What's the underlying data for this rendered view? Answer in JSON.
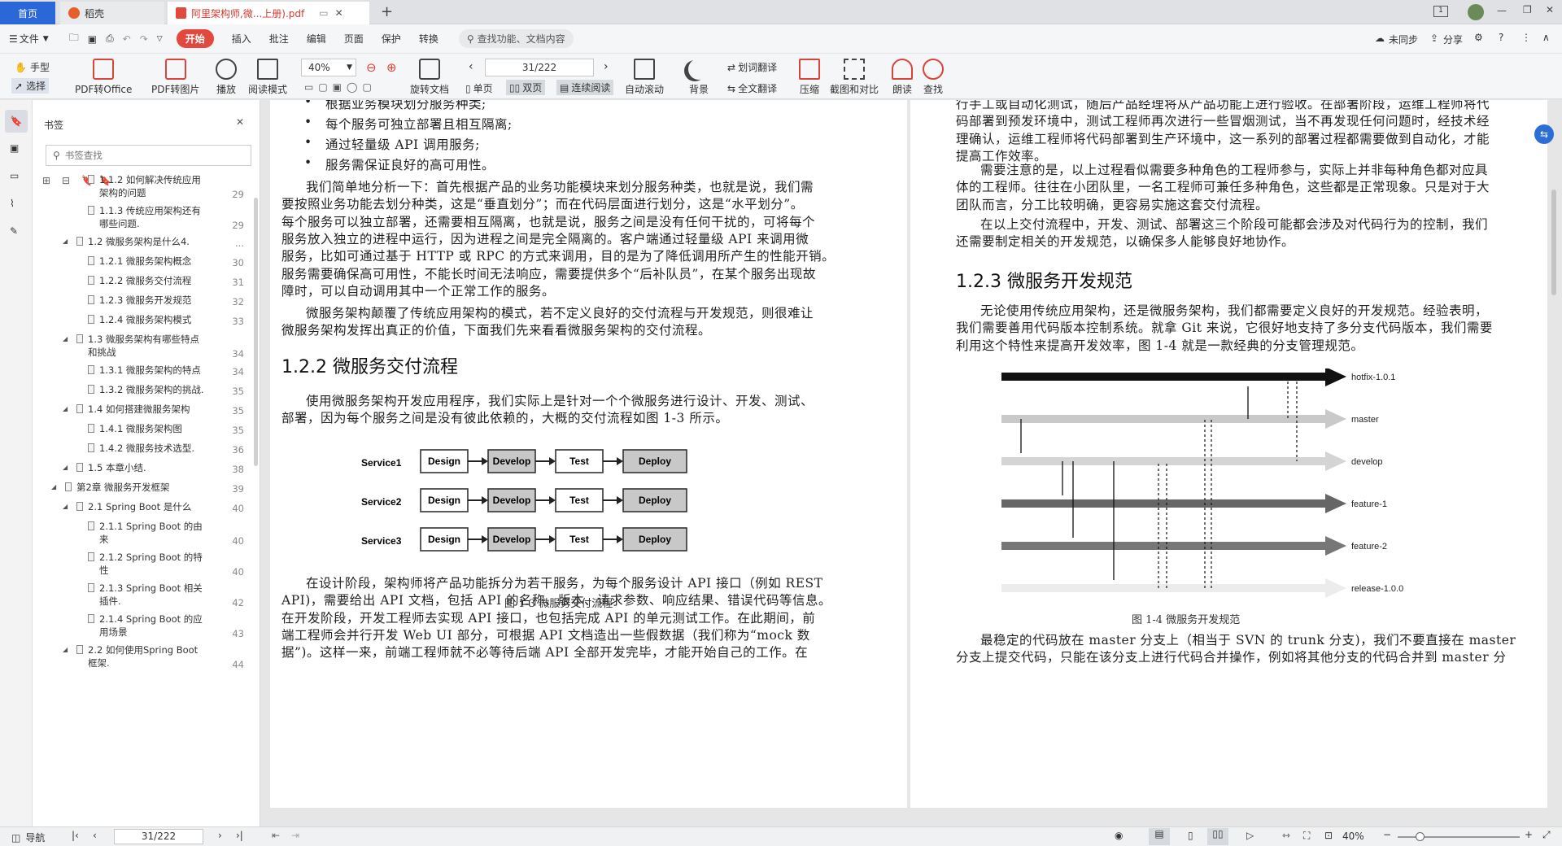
{
  "tabs": {
    "home": "首页",
    "daoke": "稻壳",
    "doc": "阿里架构师,微...上册).pdf"
  },
  "menu": {
    "file": "文件",
    "start": "开始",
    "items": [
      "插入",
      "批注",
      "编辑",
      "页面",
      "保护",
      "转换"
    ],
    "search": "查找功能、文档内容",
    "sync": "未同步",
    "share": "分享"
  },
  "ribbon": {
    "hand": "手型",
    "select": "选择",
    "pdf2office": "PDF转Office",
    "pdf2img": "PDF转图片",
    "play": "播放",
    "readmode": "阅读模式",
    "zoom": "40%",
    "page": "31/222",
    "rotate": "旋转文档",
    "single": "单页",
    "double": "双页",
    "continuous": "连续阅读",
    "autoscroll": "自动滚动",
    "background": "背景",
    "wordtrans": "划词翻译",
    "fulltrans": "全文翻译",
    "compress": "压缩",
    "screenshot": "截图和对比",
    "read": "朗读",
    "find": "查找"
  },
  "sidebar": {
    "title": "书签",
    "search_placeholder": "书签查找",
    "items": [
      {
        "l": "1.1.2 如何解决传统应用",
        "l2": "架构的问题",
        "p": "29",
        "lv": 2
      },
      {
        "l": "1.1.3 传统应用架构还有",
        "l2": "哪些问题.",
        "p": "29",
        "lv": 2
      },
      {
        "l": "1.2 微服务架构是什么4.",
        "l2": "",
        "p": "...",
        "lv": 1
      },
      {
        "l": "1.2.1 微服务架构概念",
        "l2": "",
        "p": "30",
        "lv": 2
      },
      {
        "l": "1.2.2 微服务交付流程",
        "l2": "",
        "p": "31",
        "lv": 2
      },
      {
        "l": "1.2.3 微服务开发规范",
        "l2": "",
        "p": "32",
        "lv": 2
      },
      {
        "l": "1.2.4 微服务架构模式",
        "l2": "",
        "p": "33",
        "lv": 2
      },
      {
        "l": "1.3 微服务架构有哪些特点",
        "l2": "和挑战",
        "p": "34",
        "lv": 1
      },
      {
        "l": "1.3.1 微服务架构的特点",
        "l2": "",
        "p": "34",
        "lv": 2
      },
      {
        "l": "1.3.2 微服务架构的挑战.",
        "l2": "",
        "p": "35",
        "lv": 2
      },
      {
        "l": "1.4 如何搭建微服务架构",
        "l2": "",
        "p": "35",
        "lv": 1
      },
      {
        "l": "1.4.1 微服务架构图",
        "l2": "",
        "p": "35",
        "lv": 2
      },
      {
        "l": "1.4.2 微服务技术选型.",
        "l2": "",
        "p": "36",
        "lv": 2
      },
      {
        "l": "1.5 本章小结.",
        "l2": "",
        "p": "38",
        "lv": 1
      },
      {
        "l": "第2章 微服务开发框架",
        "l2": "",
        "p": "39",
        "lv": 0
      },
      {
        "l": "2.1 Spring Boot 是什么",
        "l2": "",
        "p": "40",
        "lv": 1
      },
      {
        "l": "2.1.1 Spring Boot 的由",
        "l2": "来",
        "p": "40",
        "lv": 2
      },
      {
        "l": "2.1.2 Spring Boot 的特",
        "l2": "性",
        "p": "40",
        "lv": 2
      },
      {
        "l": "2.1.3 Spring Boot 相关",
        "l2": "插件.",
        "p": "42",
        "lv": 2
      },
      {
        "l": "2.1.4 Spring Boot 的应",
        "l2": "用场景",
        "p": "43",
        "lv": 2
      },
      {
        "l": "2.2 如何使用Spring Boot",
        "l2": "框架.",
        "p": "44",
        "lv": 1
      }
    ]
  },
  "left_page": {
    "bullets": [
      "根据业务模块划分服务种类;",
      "每个服务可独立部署且相互隔离;",
      "通过轻量级 API 调用服务;",
      "服务需保证良好的高可用性。"
    ],
    "para1": [
      "我们简单地分析一下：首先根据产品的业务功能模块来划分服务种类，也就是说，我们需",
      "要按照业务功能去划分种类，这是“垂直划分”；而在代码层面进行划分，这是“水平划分”。",
      "每个服务可以独立部署，还需要相互隔离，也就是说，服务之间是没有任何干扰的，可将每个",
      "服务放入独立的进程中运行，因为进程之间是完全隔离的。客户端通过轻量级 API 来调用微",
      "服务，比如可通过基于 HTTP 或 RPC 的方式来调用，目的是为了降低调用所产生的性能开销。",
      "服务需要确保高可用性，不能长时间无法响应，需要提供多个“后补队员”，在某个服务出现故",
      "障时，可以自动调用其中一个正常工作的服务。"
    ],
    "para2": [
      "微服务架构颠覆了传统应用架构的模式，若不定义良好的交付流程与开发规范，则很难让",
      "微服务架构发挥出真正的价值，下面我们先来看看微服务架构的交付流程。"
    ],
    "heading": "1.2.2   微服务交付流程",
    "para3": [
      "使用微服务架构开发应用程序，我们实际上是针对一个个微服务进行设计、开发、测试、",
      "部署，因为每个服务之间是没有彼此依赖的，大概的交付流程如图 1-3 所示。"
    ],
    "fig_services": [
      "Service1",
      "Service2",
      "Service3"
    ],
    "fig_steps": [
      "Design",
      "Develop",
      "Test",
      "Deploy"
    ],
    "fig_caption": "图 1-3    微服务交付流程",
    "para4": [
      "在设计阶段，架构师将产品功能拆分为若干服务，为每个服务设计 API 接口（例如 REST",
      "API)，需要给出 API 文档，包括 API 的名称、版本、请求参数、响应结果、错误代码等信息。",
      "在开发阶段，开发工程师去实现 API 接口，也包括完成 API 的单元测试工作。在此期间，前",
      "端工程师会并行开发 Web UI 部分，可根据 API 文档造出一些假数据（我们称为“mock 数",
      "据”)。这样一来，前端工程师就不必等待后端 API 全部开发完毕，才能开始自己的工作。在"
    ]
  },
  "right_page": {
    "para1": [
      "行手工或自动化测试，随后产品经理将从产品功能上进行验收。在部署阶段，运维工程师将代",
      "码部署到预发环境中，测试工程师再次进行一些冒烟测试，当不再发现任何问题时，经技术经",
      "理确认，运维工程师将代码部署到生产环境中，这一系列的部署过程都需要做到自动化，才能",
      "提高工作效率。"
    ],
    "para2": [
      "需要注意的是，以上过程看似需要多种角色的工程师参与，实际上并非每种角色都对应具",
      "体的工程师。往往在小团队里，一名工程师可兼任多种角色，这些都是正常现象。只是对于大",
      "团队而言，分工比较明确，更容易实施这套交付流程。"
    ],
    "para3": [
      "在以上交付流程中，开发、测试、部署这三个阶段可能都会涉及对代码行为的控制，我们",
      "还需要制定相关的开发规范，以确保多人能够良好地协作。"
    ],
    "heading": "1.2.3   微服务开发规范",
    "para4": [
      "无论使用传统应用架构，还是微服务架构，我们都需要定义良好的开发规范。经验表明，",
      "我们需要善用代码版本控制系统。就拿 Git 来说，它很好地支持了多分支代码版本，我们需要",
      "利用这个特性来提高开发效率，图 1-4 就是一款经典的分支管理规范。"
    ],
    "branches": [
      "hotfix-1.0.1",
      "master",
      "develop",
      "feature-1",
      "feature-2",
      "release-1.0.0"
    ],
    "fig_caption": "图 1-4    微服务开发规范",
    "para5": [
      "最稳定的代码放在 master 分支上（相当于 SVN 的 trunk 分支)，我们不要直接在 master",
      "分支上提交代码，只能在该分支上进行代码合并操作，例如将其他分支的代码合并到 master 分"
    ]
  },
  "status": {
    "nav": "导航",
    "page": "31/222",
    "zoom": "40%"
  }
}
